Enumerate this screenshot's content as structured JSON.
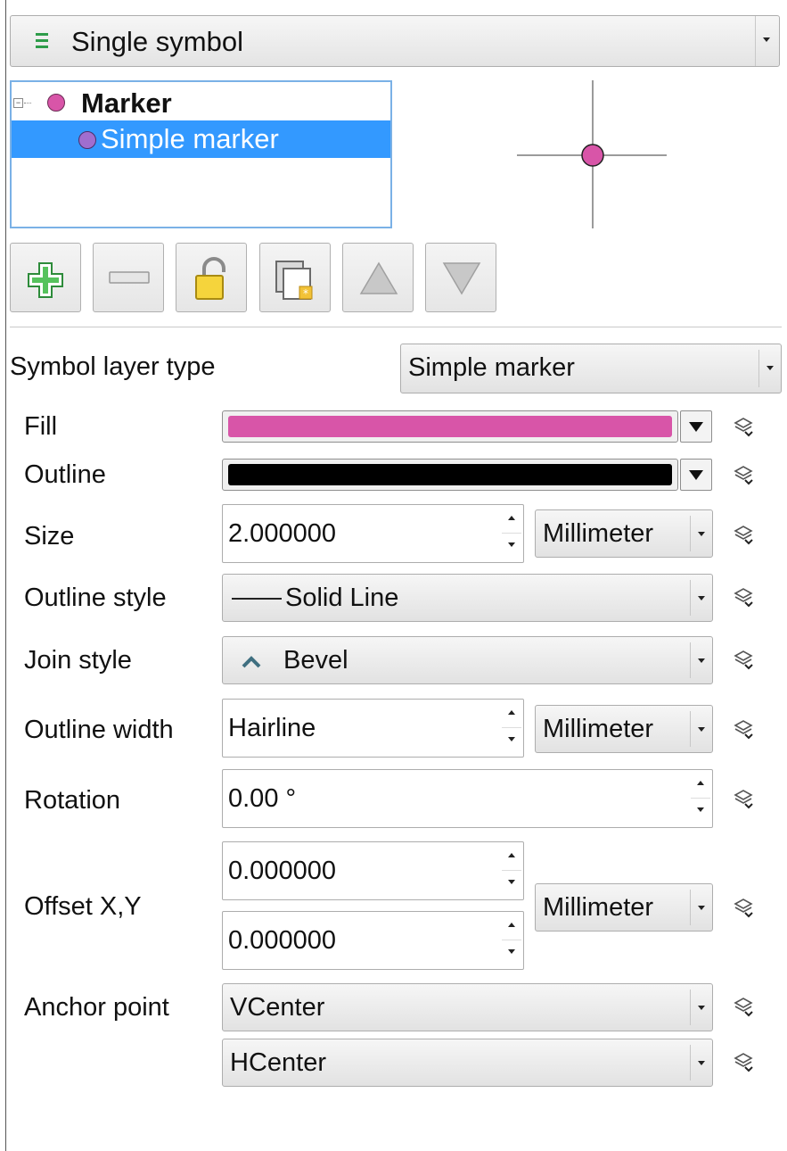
{
  "renderer": {
    "label": "Single symbol",
    "icon": "renderer-list-icon"
  },
  "tree": {
    "root": {
      "label": "Marker",
      "color": "#d855a8"
    },
    "child": {
      "label": "Simple marker",
      "color": "#a06ecf"
    }
  },
  "preview": {
    "marker_color": "#d855a8"
  },
  "toolbar": {
    "buttons": [
      {
        "name": "add-layer-button",
        "icon": "plus-icon"
      },
      {
        "name": "remove-layer-button",
        "icon": "minus-icon"
      },
      {
        "name": "lock-color-button",
        "icon": "padlock-icon"
      },
      {
        "name": "duplicate-layer-button",
        "icon": "duplicate-icon"
      },
      {
        "name": "move-up-button",
        "icon": "triangle-up-icon"
      },
      {
        "name": "move-down-button",
        "icon": "triangle-down-icon"
      }
    ]
  },
  "layer_type": {
    "label": "Symbol layer type",
    "value": "Simple marker"
  },
  "props": {
    "fill": {
      "label": "Fill",
      "color": "#d855a8"
    },
    "outline": {
      "label": "Outline",
      "color": "#000000"
    },
    "size": {
      "label": "Size",
      "value": "2.000000",
      "unit": "Millimeter"
    },
    "outline_style": {
      "label": "Outline style",
      "value": "Solid Line"
    },
    "join_style": {
      "label": "Join style",
      "value": "Bevel"
    },
    "outline_width": {
      "label": "Outline width",
      "value": "Hairline",
      "unit": "Millimeter"
    },
    "rotation": {
      "label": "Rotation",
      "value": "0.00 °"
    },
    "offset": {
      "label": "Offset X,Y",
      "x": "0.000000",
      "y": "0.000000",
      "unit": "Millimeter"
    },
    "anchor": {
      "label": "Anchor point",
      "vertical": "VCenter",
      "horizontal": "HCenter"
    }
  }
}
